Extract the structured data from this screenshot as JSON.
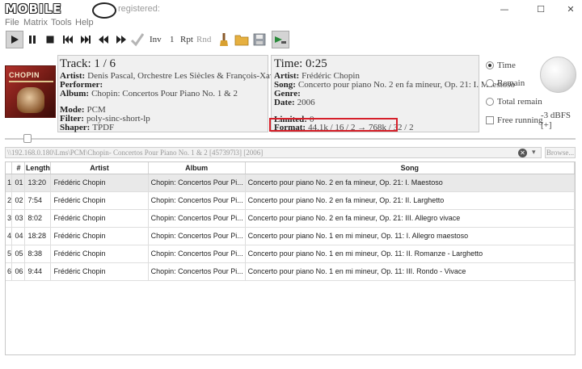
{
  "window": {
    "logo_text": "MOBILE",
    "title": "registered:",
    "min": "—",
    "max": "☐",
    "close": "✕"
  },
  "menu": [
    "File",
    "Matrix",
    "Tools",
    "Help"
  ],
  "toolbar": {
    "inv": "Inv",
    "one": "1",
    "rpt": "Rpt",
    "rnd": "Rnd"
  },
  "cover": {
    "title": "CHOPIN"
  },
  "track": {
    "heading": "Track: 1 / 6",
    "artist_label": "Artist:",
    "artist": "Denis Pascal, Orchestre Les Siècles & François-Xavier Roth",
    "performer_label": "Performer:",
    "performer": "",
    "album_label": "Album:",
    "album": "Chopin: Concertos Pour Piano No. 1 & 2",
    "mode_label": "Mode:",
    "mode": "PCM",
    "filter_label": "Filter:",
    "filter": "poly-sinc-short-lp",
    "shaper_label": "Shaper:",
    "shaper": "TPDF"
  },
  "time": {
    "heading": "Time: 0:25",
    "artist_label": "Artist:",
    "artist": "Frédéric Chopin",
    "song_label": "Song:",
    "song": "Concerto pour piano No. 2 en fa mineur, Op. 21: I. Maestoso",
    "genre_label": "Genre:",
    "genre": "",
    "date_label": "Date:",
    "date": "2006",
    "limited_label": "Limited:",
    "limited": "0",
    "format_label": "Format:",
    "format": "44.1k / 16 / 2 → 768k / 32 / 2"
  },
  "display_mode": {
    "options": [
      "Time",
      "Remain",
      "Total remain"
    ],
    "selected": "Time"
  },
  "free_running": {
    "label": "Free running",
    "checked": false
  },
  "volume": {
    "label": "-3 dBFS [+]"
  },
  "seek": {
    "position_fraction": 0.032
  },
  "path": {
    "value": "\\\\192.168.0.180\\Lms\\PCM\\Chopin- Concertos Pour Piano No. 1 & 2 [457397l3] [2006]",
    "clear_icon": "✕",
    "dropdown_icon": "▾",
    "browse_label": "Browse..."
  },
  "playlist": {
    "columns": [
      "",
      "#",
      "Length",
      "Artist",
      "Album",
      "Song"
    ],
    "rows": [
      [
        "1",
        "01",
        "13:20",
        "Frédéric Chopin",
        "Chopin: Concertos Pour Pi...",
        "Concerto pour piano No. 2 en fa mineur, Op. 21: I. Maestoso"
      ],
      [
        "2",
        "02",
        "7:54",
        "Frédéric Chopin",
        "Chopin: Concertos Pour Pi...",
        "Concerto pour piano No. 2 en fa mineur, Op. 21: II. Larghetto"
      ],
      [
        "3",
        "03",
        "8:02",
        "Frédéric Chopin",
        "Chopin: Concertos Pour Pi...",
        "Concerto pour piano No. 2 en fa mineur, Op. 21: III. Allegro vivace"
      ],
      [
        "4",
        "04",
        "18:28",
        "Frédéric Chopin",
        "Chopin: Concertos Pour Pi...",
        "Concerto pour piano No. 1 en mi mineur, Op. 11: I. Allegro maestoso"
      ],
      [
        "5",
        "05",
        "8:38",
        "Frédéric Chopin",
        "Chopin: Concertos Pour Pi...",
        "Concerto pour piano No. 1 en mi mineur, Op. 11: II. Romanze - Larghetto"
      ],
      [
        "6",
        "06",
        "9:44",
        "Frédéric Chopin",
        "Chopin: Concertos Pour Pi...",
        "Concerto pour piano No. 1 en mi mineur, Op. 11: III. Rondo - Vivace"
      ]
    ],
    "selected_index": 0
  },
  "colors": {
    "highlight_border": "#d6202a",
    "panel_bg": "#f0f0f0",
    "selected_row": "#e9e9e9"
  }
}
